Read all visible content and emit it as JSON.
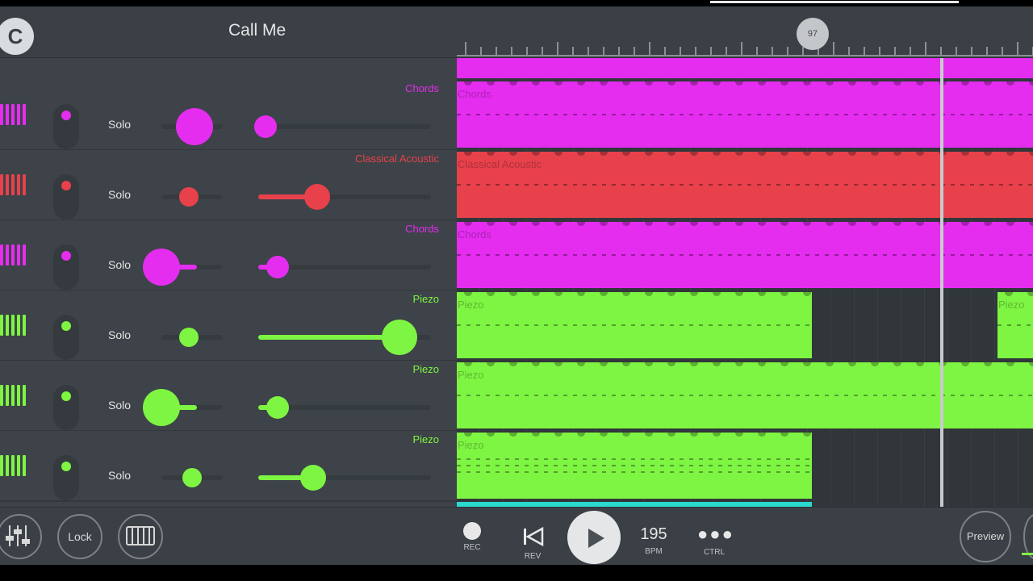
{
  "header": {
    "logo_letter": "C",
    "song_title": "Call Me",
    "position_marker": "97"
  },
  "colors": {
    "magenta": "#e52df0",
    "red": "#e8414c",
    "green": "#7ef542",
    "cyan": "#2bd9cf",
    "background": "#3d4348"
  },
  "tracks": [
    {
      "name": "Chords",
      "solo_label": "Solo",
      "color": "#e52df0",
      "icon": "piano-keys-icon",
      "pan": 0.55,
      "volume": 0.04
    },
    {
      "name": "Classical Acoustic",
      "solo_label": "Solo",
      "color": "#e8414c",
      "icon": "piano-keys-icon",
      "pan": 0.45,
      "volume": 0.34
    },
    {
      "name": "Chords",
      "solo_label": "Solo",
      "color": "#e52df0",
      "icon": "piano-keys-icon",
      "pan": 0.0,
      "volume": 0.11
    },
    {
      "name": "Piezo",
      "solo_label": "Solo",
      "color": "#7ef542",
      "icon": "piano-keys-icon",
      "pan": 0.45,
      "volume": 0.82
    },
    {
      "name": "Piezo",
      "solo_label": "Solo",
      "color": "#7ef542",
      "icon": "piano-keys-icon",
      "pan": 0.0,
      "volume": 0.11
    },
    {
      "name": "Piezo",
      "solo_label": "Solo",
      "color": "#7ef542",
      "icon": "piano-keys-icon",
      "pan": 0.5,
      "volume": 0.32
    }
  ],
  "clips": [
    {
      "label": "Chords"
    },
    {
      "label": "Classical Acoustic"
    },
    {
      "label": "Chords"
    },
    {
      "label": "Piezo"
    },
    {
      "label": "Piezo"
    },
    {
      "label": "Piezo"
    },
    {
      "label": "Piezo"
    }
  ],
  "toolbar": {
    "mixer_icon": "mixer-sliders-icon",
    "lock_label": "Lock",
    "keyboard_icon": "piano-keys-icon",
    "rec_label": "REC",
    "rev_label": "REV",
    "bpm_value": "195",
    "bpm_label": "BPM",
    "ctrl_label": "CTRL",
    "preview_label": "Preview"
  }
}
